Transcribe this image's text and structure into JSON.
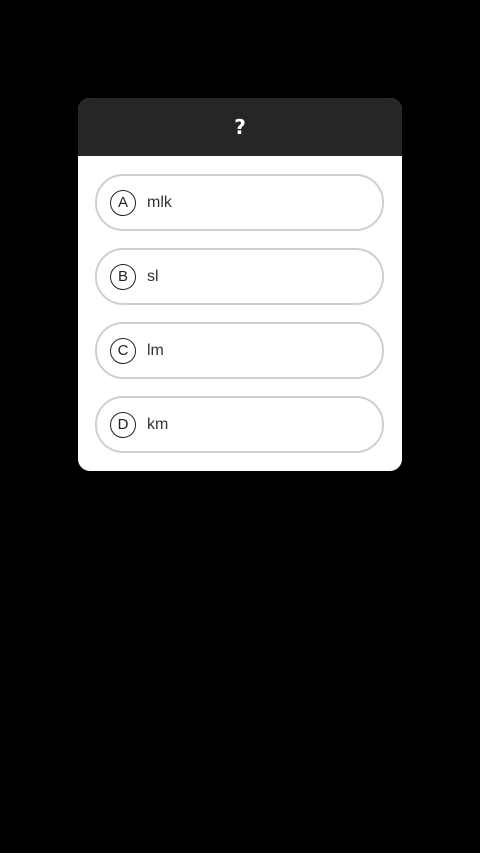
{
  "dialog": {
    "title": "?",
    "options": [
      {
        "letter": "A",
        "text": "mlk"
      },
      {
        "letter": "B",
        "text": "sl"
      },
      {
        "letter": "C",
        "text": "lm"
      },
      {
        "letter": "D",
        "text": "km"
      }
    ]
  },
  "colors": {
    "background": "#000000",
    "header": "#262626",
    "card": "#ffffff",
    "option_border": "#cfcfcf"
  }
}
